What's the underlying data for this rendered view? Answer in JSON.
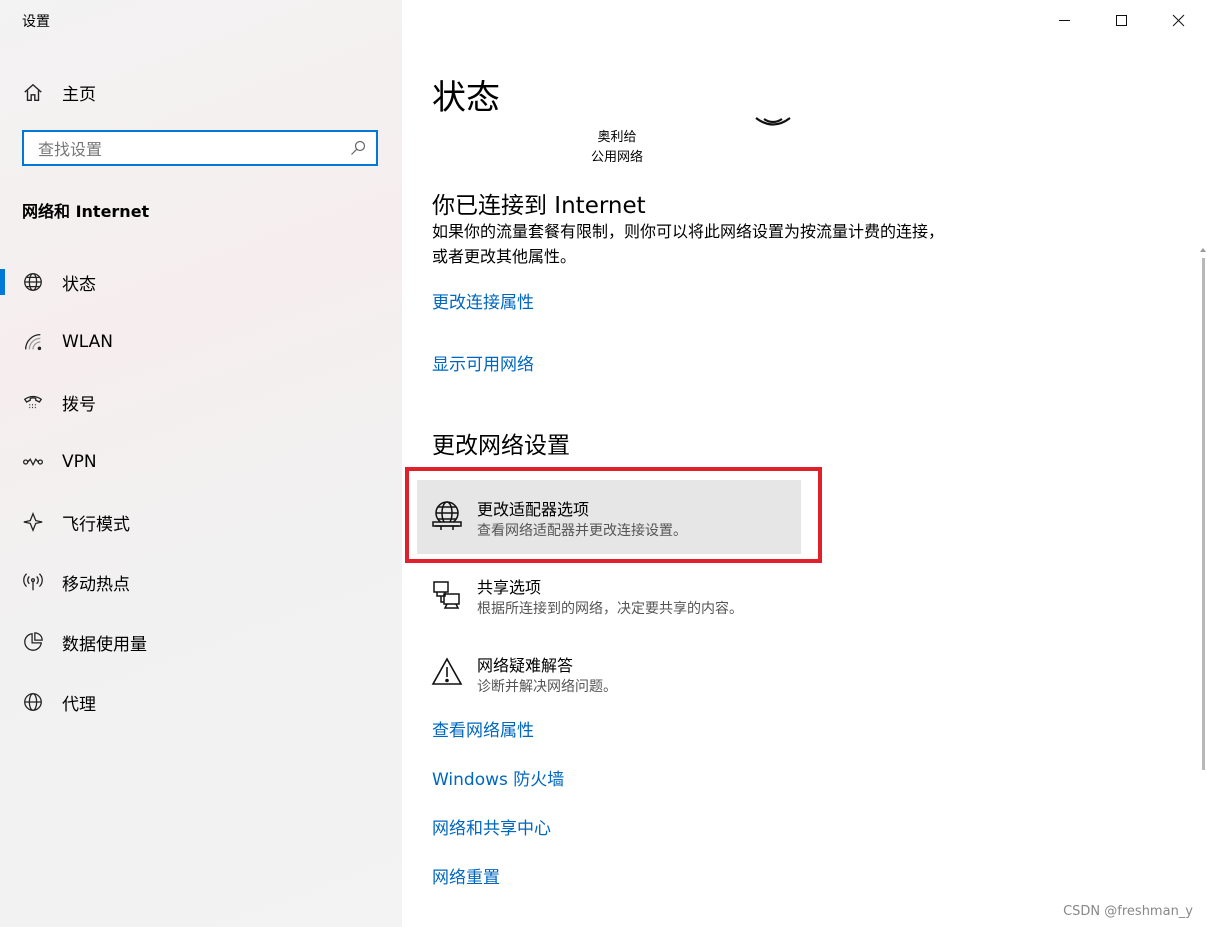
{
  "window": {
    "title": "设置"
  },
  "sidebar": {
    "home_label": "主页",
    "search_placeholder": "查找设置",
    "section_title": "网络和 Internet",
    "items": [
      {
        "label": "状态",
        "icon": "globe-icon",
        "active": true
      },
      {
        "label": "WLAN",
        "icon": "wifi-icon"
      },
      {
        "label": "拨号",
        "icon": "dialup-icon"
      },
      {
        "label": "VPN",
        "icon": "vpn-icon"
      },
      {
        "label": "飞行模式",
        "icon": "airplane-icon"
      },
      {
        "label": "移动热点",
        "icon": "hotspot-icon"
      },
      {
        "label": "数据使用量",
        "icon": "pie-chart-icon"
      },
      {
        "label": "代理",
        "icon": "globe-icon"
      }
    ]
  },
  "main": {
    "page_title": "状态",
    "network": {
      "name": "奥利给",
      "type": "公用网络"
    },
    "connected_heading": "你已连接到 Internet",
    "connected_desc": "如果你的流量套餐有限制，则你可以将此网络设置为按流量计费的连接，或者更改其他属性。",
    "links_top": [
      "更改连接属性",
      "显示可用网络"
    ],
    "change_heading": "更改网络设置",
    "options": [
      {
        "title": "更改适配器选项",
        "desc": "查看网络适配器并更改连接设置。",
        "icon": "adapter-icon"
      },
      {
        "title": "共享选项",
        "desc": "根据所连接到的网络，决定要共享的内容。",
        "icon": "sharing-icon"
      },
      {
        "title": "网络疑难解答",
        "desc": "诊断并解决网络问题。",
        "icon": "warning-icon"
      }
    ],
    "links_bottom": [
      "查看网络属性",
      "Windows 防火墙",
      "网络和共享中心",
      "网络重置"
    ]
  },
  "watermark": "CSDN @freshman_y",
  "colors": {
    "accent": "#0078d7",
    "link": "#0067c0",
    "highlight_border": "#e0202a"
  }
}
